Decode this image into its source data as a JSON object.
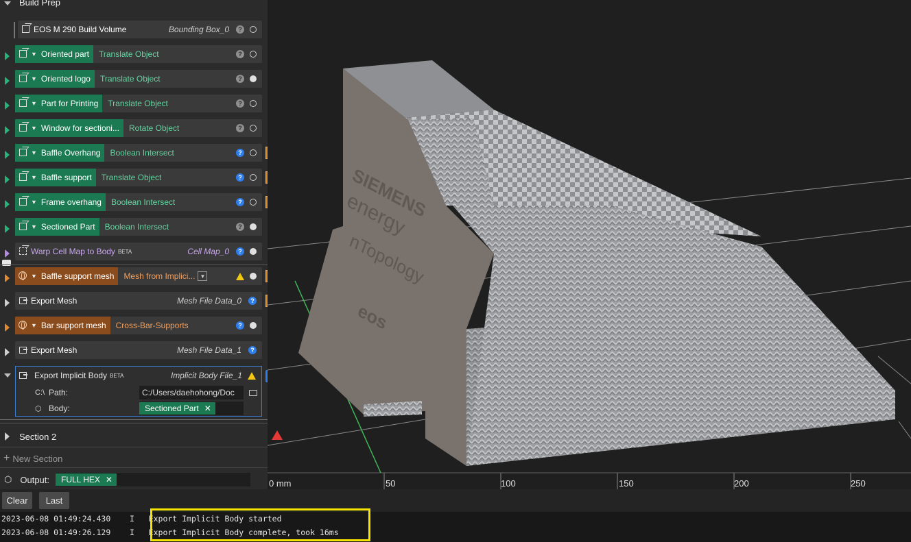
{
  "section_title": "Build Prep",
  "nodes": [
    {
      "label": "EOS M 290 Build Volume",
      "op": "Bounding Box_0"
    },
    {
      "label": "Oriented part",
      "op": "Translate Object"
    },
    {
      "label": "Oriented logo",
      "op": "Translate Object"
    },
    {
      "label": "Part for Printing",
      "op": "Translate Object"
    },
    {
      "label": "Window for sectioni...",
      "op": "Rotate Object"
    },
    {
      "label": "Baffle Overhang",
      "op": "Boolean Intersect"
    },
    {
      "label": "Baffle support",
      "op": "Translate Object"
    },
    {
      "label": "Frame overhang",
      "op": "Boolean Intersect"
    },
    {
      "label": "Sectioned Part",
      "op": "Boolean Intersect"
    },
    {
      "label": "Warp Cell Map to Body",
      "beta": "BETA",
      "op": "Cell Map_0"
    },
    {
      "label": "Baffle support mesh",
      "op": "Mesh from Implici..."
    },
    {
      "label": "Export Mesh",
      "op": "Mesh File Data_0"
    },
    {
      "label": "Bar support mesh",
      "op": "Cross-Bar-Supports"
    },
    {
      "label": "Export Mesh",
      "op": "Mesh File Data_1"
    }
  ],
  "export_implicit": {
    "label": "Export Implicit Body",
    "beta": "BETA",
    "op": "Implicit Body File_1",
    "path_icon": "C:\\",
    "path_label": "Path:",
    "path_value": "C:/Users/daehohong/Doc",
    "body_label": "Body:",
    "body_value": "Sectioned Part",
    "remove_glyph": "✕",
    "add_glyph": "+"
  },
  "section2": "Section 2",
  "new_section": "New Section",
  "new_section_glyph": "+",
  "output_label": "Output:",
  "output_value": "FULL HEX",
  "output_remove_glyph": "✕",
  "help_glyph": "?",
  "axis": {
    "t0": "0 mm",
    "t50": "50",
    "t100": "100",
    "t150": "150",
    "t200": "200",
    "t250": "250"
  },
  "model_text": {
    "line1": "SIEMENS",
    "line2": "energy",
    "line3": "nTopology",
    "line4": "eos"
  },
  "console": {
    "clear": "Clear",
    "last": "Last",
    "lines": [
      {
        "time": "2023-06-08 01:49:24.430",
        "level": "I",
        "msg": "Export Implicit Body started"
      },
      {
        "time": "2023-06-08 01:49:26.129",
        "level": "I",
        "msg": "Export Implicit Body complete, took 16ms"
      }
    ]
  },
  "colors": {
    "accent_green": "#1b7a52",
    "op_green": "#63d3a0",
    "orange": "#d98b2b",
    "blue": "#2e7de9",
    "highlight": "#f5e400"
  }
}
